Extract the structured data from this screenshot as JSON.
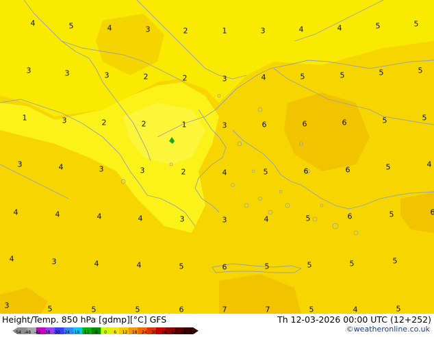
{
  "title": "Height/Temp. 850 hPa [gdmp][°C] GFS",
  "timestamp": "Th 12-03-2026 00:00 UTC (12+252)",
  "credit": "©weatheronline.co.uk",
  "colors": {
    "base": "#F7D600",
    "light": "#F9EA00",
    "lighter": "#FBF21A",
    "darker": "#F2C400",
    "coast": "#9aa0a8",
    "green_spot": "#1fa41f"
  },
  "scale": {
    "tick_labels": [
      "-54",
      "-48",
      "-42",
      "-38",
      "-30",
      "-24",
      "-18",
      "-12",
      "-6",
      "0",
      "6",
      "12",
      "18",
      "24",
      "30",
      "36",
      "42",
      "48",
      "54"
    ],
    "colors": [
      "#8c8c8c",
      "#a8a8a8",
      "#c800c8",
      "#9c3cff",
      "#3c3cff",
      "#2c8cff",
      "#00c8ff",
      "#00b400",
      "#008c00",
      "#c8ff00",
      "#f7e600",
      "#f7c800",
      "#f79600",
      "#f76400",
      "#e03200",
      "#c80000",
      "#960000",
      "#5a0000",
      "#3a0000"
    ]
  },
  "temperature_labels": [
    {
      "v": "4"
    },
    {
      "v": "5"
    },
    {
      "v": "4"
    },
    {
      "v": "3"
    },
    {
      "v": "2"
    },
    {
      "v": "1"
    },
    {
      "v": "3"
    },
    {
      "v": "4"
    },
    {
      "v": "4"
    },
    {
      "v": "5"
    },
    {
      "v": "5"
    },
    {
      "v": "3"
    },
    {
      "v": "3"
    },
    {
      "v": "3"
    },
    {
      "v": "2"
    },
    {
      "v": "2"
    },
    {
      "v": "3"
    },
    {
      "v": "4"
    },
    {
      "v": "5"
    },
    {
      "v": "5"
    },
    {
      "v": "5"
    },
    {
      "v": "5"
    },
    {
      "v": "1"
    },
    {
      "v": "3"
    },
    {
      "v": "2"
    },
    {
      "v": "2"
    },
    {
      "v": "1"
    },
    {
      "v": "3"
    },
    {
      "v": "6"
    },
    {
      "v": "6"
    },
    {
      "v": "6"
    },
    {
      "v": "5"
    },
    {
      "v": "5"
    },
    {
      "v": "3"
    },
    {
      "v": "4"
    },
    {
      "v": "3"
    },
    {
      "v": "3"
    },
    {
      "v": "2"
    },
    {
      "v": "4"
    },
    {
      "v": "5"
    },
    {
      "v": "6"
    },
    {
      "v": "6"
    },
    {
      "v": "5"
    },
    {
      "v": "4"
    },
    {
      "v": "4"
    },
    {
      "v": "4"
    },
    {
      "v": "4"
    },
    {
      "v": "4"
    },
    {
      "v": "3"
    },
    {
      "v": "3"
    },
    {
      "v": "4"
    },
    {
      "v": "5"
    },
    {
      "v": "6"
    },
    {
      "v": "5"
    },
    {
      "v": "6"
    },
    {
      "v": "4"
    },
    {
      "v": "3"
    },
    {
      "v": "4"
    },
    {
      "v": "4"
    },
    {
      "v": "5"
    },
    {
      "v": "6"
    },
    {
      "v": "5"
    },
    {
      "v": "5"
    },
    {
      "v": "5"
    },
    {
      "v": "5"
    },
    {
      "v": "3"
    },
    {
      "v": "5"
    },
    {
      "v": "5"
    },
    {
      "v": "5"
    },
    {
      "v": "6"
    },
    {
      "v": "7"
    },
    {
      "v": "7"
    },
    {
      "v": "5"
    },
    {
      "v": "4"
    },
    {
      "v": "5"
    }
  ]
}
